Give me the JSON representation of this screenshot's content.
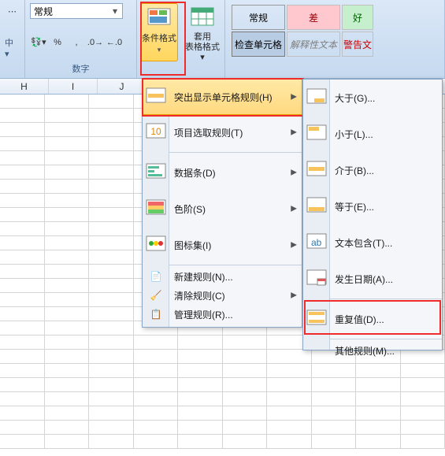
{
  "ribbon": {
    "number_format": "常规",
    "cond_fmt_label": "条件格式",
    "table_fmt_label": "套用\n表格格式",
    "group_number": "数字",
    "style_normal": "常规",
    "style_bad": "差",
    "style_good": "好",
    "style_check": "检查单元格",
    "style_explain": "解释性文本",
    "style_warn": "警告文"
  },
  "cols": [
    "H",
    "I",
    "J"
  ],
  "menu1": {
    "highlight": "突出显示单元格规则(H)",
    "topbottom": "项目选取规则(T)",
    "databar": "数据条(D)",
    "colorscale": "色阶(S)",
    "iconset": "图标集(I)",
    "newrule": "新建规则(N)...",
    "clear": "清除规则(C)",
    "manage": "管理规则(R)..."
  },
  "menu2": {
    "gt": "大于(G)...",
    "lt": "小于(L)...",
    "between": "介于(B)...",
    "eq": "等于(E)...",
    "text": "文本包含(T)...",
    "date": "发生日期(A)...",
    "dup": "重复值(D)...",
    "other": "其他规则(M)..."
  }
}
